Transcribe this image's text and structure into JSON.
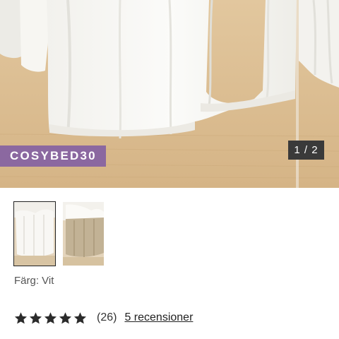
{
  "gallery": {
    "promo_code": "COSYBED30",
    "pager": "1 / 2"
  },
  "thumbnails": [
    {
      "color": "white",
      "selected": true
    },
    {
      "color": "beige",
      "selected": false
    }
  ],
  "product": {
    "color_label": "Färg: Vit"
  },
  "reviews": {
    "rating": 5,
    "max_rating": 5,
    "count_text": "(26)",
    "link_text": "5 recensioner"
  },
  "colors": {
    "promo_badge": "#8b68a0",
    "pager_badge": "#3a3a3a",
    "floor": "#d8b98e",
    "fabric_white": "#f6f5f1",
    "fabric_beige": "#bfae93"
  }
}
